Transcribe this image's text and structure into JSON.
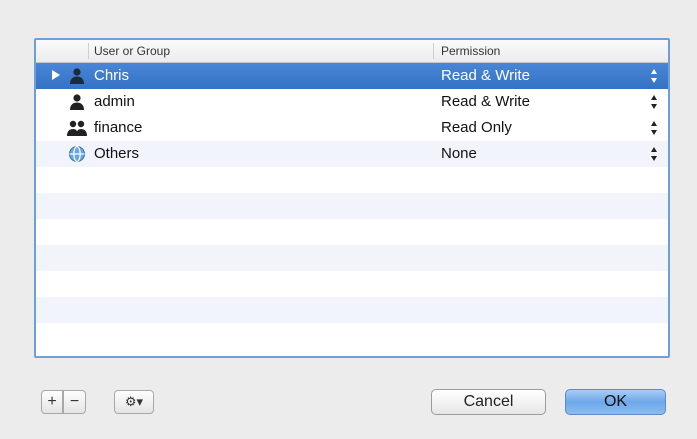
{
  "table": {
    "columns": {
      "user": "User or Group",
      "permission": "Permission"
    },
    "rows": [
      {
        "name": "Chris",
        "permission": "Read & Write",
        "icon": "single-user-icon",
        "selected": true
      },
      {
        "name": "admin",
        "permission": "Read & Write",
        "icon": "single-user-icon",
        "selected": false
      },
      {
        "name": "finance",
        "permission": "Read Only",
        "icon": "group-icon",
        "selected": false
      },
      {
        "name": "Others",
        "permission": "None",
        "icon": "globe-icon",
        "selected": false
      }
    ]
  },
  "footer": {
    "add_label": "+",
    "remove_label": "−",
    "action_label": "⚙▾",
    "cancel_label": "Cancel",
    "ok_label": "OK"
  },
  "colors": {
    "selection": "#3a78cc",
    "frame_focus": "#6f9fd9",
    "default_button": "#6ea7ea"
  }
}
